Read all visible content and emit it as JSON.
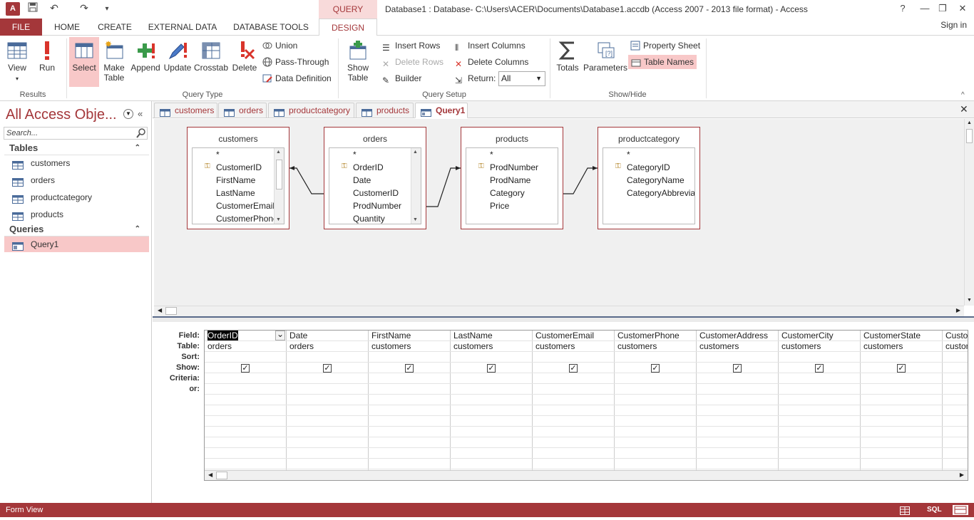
{
  "titlebar": {
    "app_icon": "A",
    "context_tab": "QUERY TOOLS",
    "window_title": "Database1 : Database- C:\\Users\\ACER\\Documents\\Database1.accdb (Access 2007 - 2013 file format) - Access",
    "help": "?",
    "minimize": "—",
    "restore": "❐",
    "close": "✕"
  },
  "ribbon_tabs": {
    "file": "FILE",
    "home": "HOME",
    "create": "CREATE",
    "external": "EXTERNAL DATA",
    "dbtools": "DATABASE TOOLS",
    "design": "DESIGN",
    "signin": "Sign in"
  },
  "ribbon": {
    "results": {
      "label": "Results",
      "view": "View",
      "run": "Run"
    },
    "query_type": {
      "label": "Query Type",
      "select": "Select",
      "make_table": "Make Table",
      "make_table_l1": "Make",
      "make_table_l2": "Table",
      "append": "Append",
      "update": "Update",
      "crosstab": "Crosstab",
      "delete": "Delete",
      "union": "Union",
      "pass_through": "Pass-Through",
      "data_definition": "Data Definition"
    },
    "query_setup": {
      "label": "Query Setup",
      "show_table_l1": "Show",
      "show_table_l2": "Table",
      "insert_rows": "Insert Rows",
      "delete_rows": "Delete Rows",
      "builder": "Builder",
      "insert_columns": "Insert Columns",
      "delete_columns": "Delete Columns",
      "return_label": "Return:",
      "return_value": "All"
    },
    "show_hide": {
      "label": "Show/Hide",
      "totals": "Totals",
      "parameters": "Parameters",
      "property_sheet": "Property Sheet",
      "table_names": "Table Names"
    }
  },
  "nav": {
    "title": "All Access Obje...",
    "search_placeholder": "Search...",
    "tables_header": "Tables",
    "queries_header": "Queries",
    "tables": [
      "customers",
      "orders",
      "productcategory",
      "products"
    ],
    "queries": [
      "Query1"
    ]
  },
  "doc_tabs": [
    "customers",
    "orders",
    "productcategory",
    "products",
    "Query1"
  ],
  "tables": [
    {
      "name": "customers",
      "fields": [
        "*",
        "CustomerID",
        "FirstName",
        "LastName",
        "CustomerEmail",
        "CustomerPhone"
      ],
      "key_index": 1
    },
    {
      "name": "orders",
      "fields": [
        "*",
        "OrderID",
        "Date",
        "CustomerID",
        "ProdNumber",
        "Quantity"
      ],
      "key_index": 1
    },
    {
      "name": "products",
      "fields": [
        "*",
        "ProdNumber",
        "ProdName",
        "Category",
        "Price"
      ],
      "key_index": 1
    },
    {
      "name": "productcategory",
      "fields": [
        "*",
        "CategoryID",
        "CategoryName",
        "CategoryAbbreviat"
      ],
      "key_index": 1
    }
  ],
  "grid": {
    "row_labels": [
      "Field:",
      "Table:",
      "Sort:",
      "Show:",
      "Criteria:",
      "or:"
    ],
    "columns": [
      {
        "field": "OrderID",
        "table": "orders",
        "show": true
      },
      {
        "field": "Date",
        "table": "orders",
        "show": true
      },
      {
        "field": "FirstName",
        "table": "customers",
        "show": true
      },
      {
        "field": "LastName",
        "table": "customers",
        "show": true
      },
      {
        "field": "CustomerEmail",
        "table": "customers",
        "show": true
      },
      {
        "field": "CustomerPhone",
        "table": "customers",
        "show": true
      },
      {
        "field": "CustomerAddress",
        "table": "customers",
        "show": true
      },
      {
        "field": "CustomerCity",
        "table": "customers",
        "show": true
      },
      {
        "field": "CustomerState",
        "table": "customers",
        "show": true
      },
      {
        "field": "Custon",
        "table": "custom",
        "show": false
      }
    ]
  },
  "status": {
    "left": "Form View",
    "sql": "SQL"
  },
  "colors": {
    "accent": "#a4373a",
    "highlight": "#f8c8c8"
  }
}
